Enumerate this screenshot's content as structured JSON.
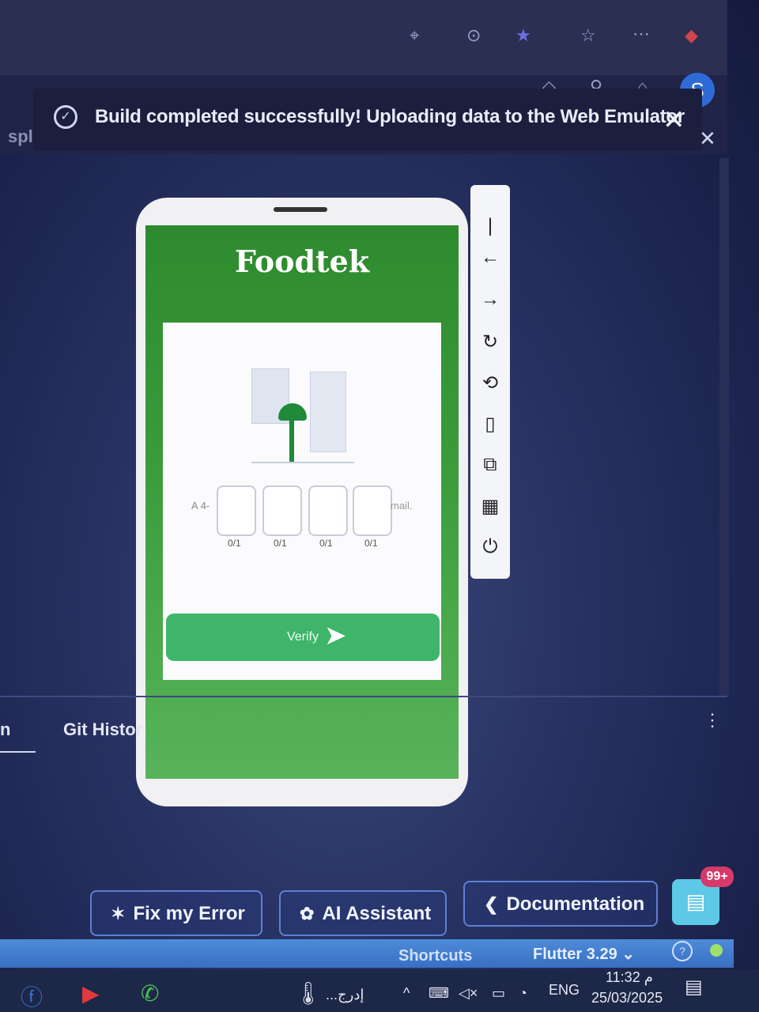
{
  "toast": {
    "message": "Build completed successfully! Uploading data to the Web Emulator"
  },
  "left_partial_label": "spl",
  "emulator": {
    "app_title": "Foodtek",
    "otp": {
      "prefix": "A 4-",
      "suffix": "mail.",
      "boxes": [
        {
          "count": "0/1"
        },
        {
          "count": "0/1"
        },
        {
          "count": "0/1"
        },
        {
          "count": "0/1"
        }
      ]
    },
    "verify_label": "Verify"
  },
  "bottom_panel": {
    "git_history_tab": "Git Histor",
    "left_tab": "n"
  },
  "actions": {
    "fix_error": "Fix my Error",
    "ai_assistant": "AI Assistant",
    "documentation": "Documentation",
    "chat_badge": "99+"
  },
  "status_bar": {
    "shortcuts": "Shortcuts",
    "flutter_version": "Flutter 3.29"
  },
  "taskbar": {
    "search_text": "...إدرج",
    "language": "ENG",
    "time": "11:32 م",
    "date": "25/03/2025"
  },
  "colors": {
    "toast_bg": "#1b1f3d",
    "app_green": "#2e8a2e",
    "verify_green": "#3fb56a",
    "status_bar_blue": "#4d8bd8",
    "badge_pink": "#d63a6a"
  }
}
